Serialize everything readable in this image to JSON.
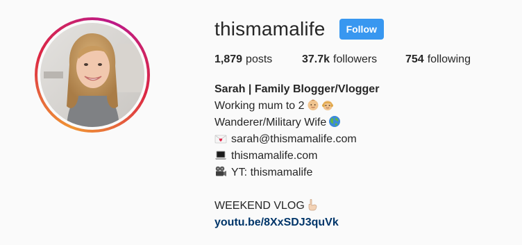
{
  "profile": {
    "username": "thismamalife",
    "follow_label": "Follow",
    "stats": {
      "posts_count": "1,879",
      "posts_label": "posts",
      "followers_count": "37.7k",
      "followers_label": "followers",
      "following_count": "754",
      "following_label": "following"
    },
    "bio": {
      "name": "Sarah | Family Blogger/Vlogger",
      "line1": "Working mum to 2",
      "line2": "Wanderer/Military Wife",
      "email": "sarah@thismamalife.com",
      "website": "thismamalife.com",
      "youtube": "YT: thismamalife",
      "vlog_label": "WEEKEND VLOG",
      "link": "youtu.be/8XxSDJ3quVk"
    },
    "icons": {
      "line1": [
        "baby-face-icon",
        "baby-girl-face-icon"
      ],
      "line2": "globe-icon",
      "email": "love-letter-icon",
      "website": "laptop-icon",
      "youtube": "film-camera-icon",
      "vlog": "pointing-down-icon"
    },
    "colors": {
      "follow_button": "#3897f0",
      "link": "#003569",
      "text": "#262626",
      "background": "#fafafa"
    }
  }
}
